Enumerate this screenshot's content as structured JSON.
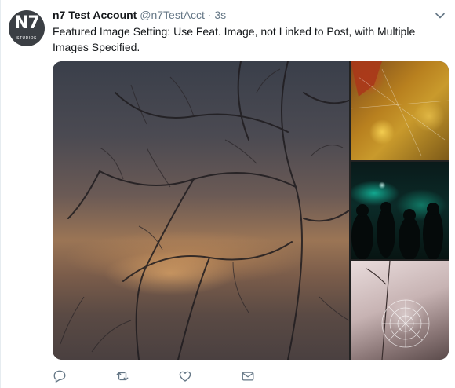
{
  "tweet": {
    "account_name": "n7 Test Account",
    "handle": "@n7TestAcct",
    "separator": "·",
    "time": "3s",
    "text": "Featured Image Setting: Use Feat. Image, not Linked to Post, with Multiple Images Specified.",
    "avatar": {
      "mark": "N7",
      "sub": "STUDIOS"
    }
  },
  "icons": {
    "caret": "chevron-down-icon",
    "reply": "reply-icon",
    "retweet": "retweet-icon",
    "like": "heart-icon",
    "dm": "envelope-icon"
  },
  "colors": {
    "text": "#14171a",
    "muted": "#657786"
  }
}
